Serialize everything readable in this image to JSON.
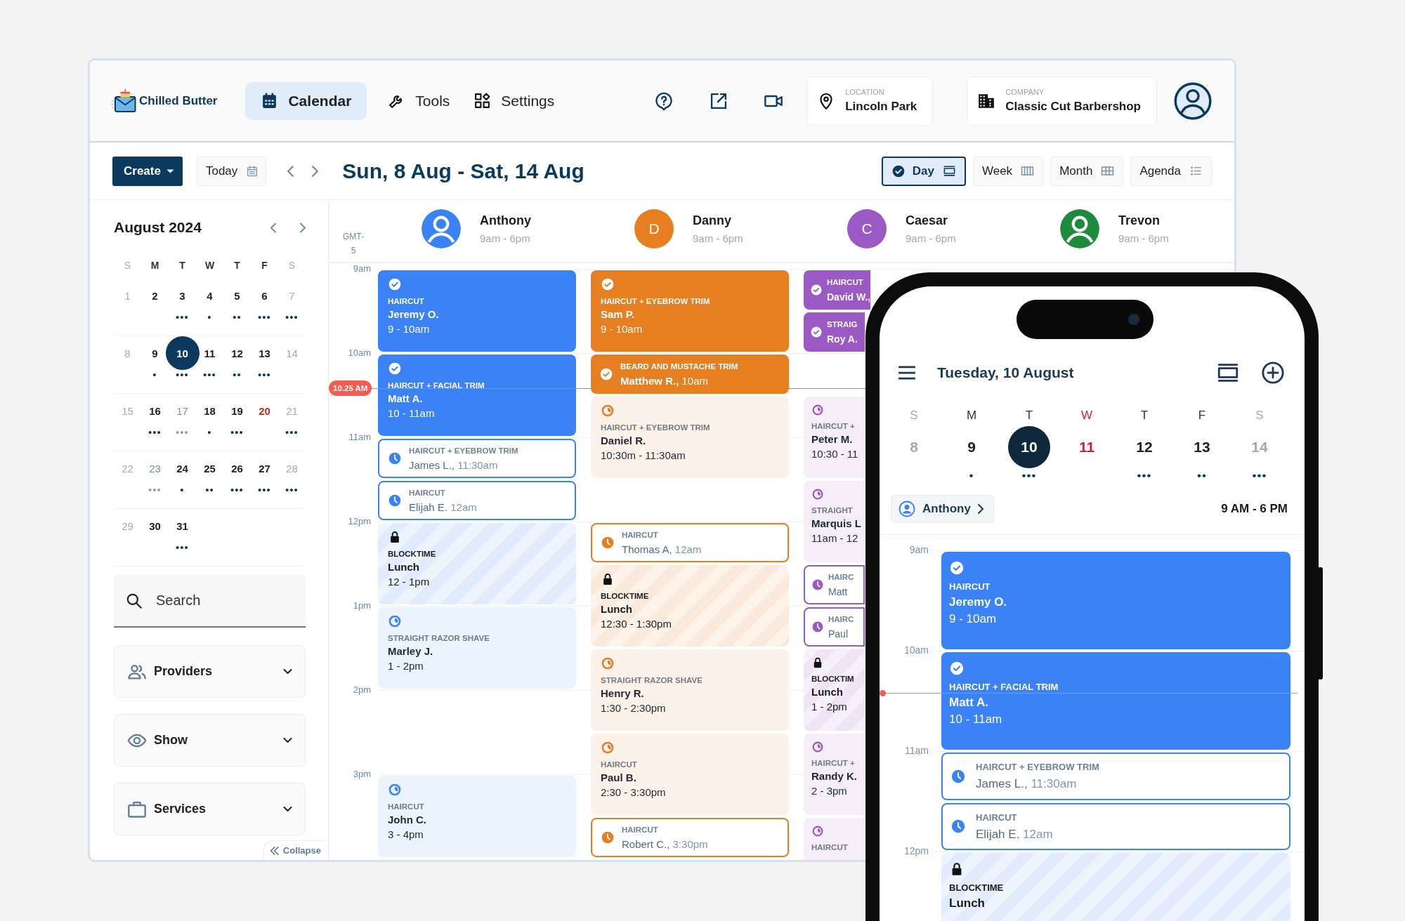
{
  "header": {
    "logo": "Chilled Butter",
    "nav": [
      {
        "label": "Calendar",
        "selected": true
      },
      {
        "label": "Tools",
        "selected": false
      },
      {
        "label": "Settings",
        "selected": false
      }
    ],
    "location": {
      "caption": "LOCATION",
      "value": "Lincoln Park"
    },
    "company": {
      "caption": "COMPANY",
      "value": "Classic Cut Barbershop"
    }
  },
  "toolbar": {
    "create": "Create",
    "today": "Today",
    "range": "Sun, 8 Aug - Sat, 14 Aug",
    "views": [
      {
        "label": "Day",
        "selected": true
      },
      {
        "label": "Week",
        "selected": false
      },
      {
        "label": "Month",
        "selected": false
      },
      {
        "label": "Agenda",
        "selected": false
      }
    ]
  },
  "sidebar": {
    "month": "August 2024",
    "weekdays": [
      "S",
      "M",
      "T",
      "W",
      "T",
      "F",
      "S"
    ],
    "weeks": [
      [
        {
          "day": "1",
          "kind": "weekend",
          "selected": false
        },
        {
          "day": "2",
          "kind": "normal",
          "selected": false
        },
        {
          "day": "3",
          "kind": "normal",
          "selected": false,
          "dots": "•••"
        },
        {
          "day": "4",
          "kind": "normal",
          "selected": false,
          "dots": "•"
        },
        {
          "day": "5",
          "kind": "normal",
          "selected": false,
          "dots": "••"
        },
        {
          "day": "6",
          "kind": "normal",
          "selected": false,
          "dots": "•••"
        },
        {
          "day": "7",
          "kind": "weekend",
          "selected": false,
          "dots": "•••"
        }
      ],
      [
        {
          "day": "8",
          "kind": "weekend",
          "selected": false
        },
        {
          "day": "9",
          "kind": "normal",
          "selected": false,
          "dots": "•"
        },
        {
          "day": "10",
          "kind": "normal",
          "selected": true,
          "dots": "•••"
        },
        {
          "day": "11",
          "kind": "normal",
          "selected": false,
          "dots": "•••"
        },
        {
          "day": "12",
          "kind": "normal",
          "selected": false,
          "dots": "••"
        },
        {
          "day": "13",
          "kind": "normal",
          "selected": false,
          "dots": "•••"
        },
        {
          "day": "14",
          "kind": "weekend",
          "selected": false
        }
      ],
      [
        {
          "day": "15",
          "kind": "weekend",
          "selected": false
        },
        {
          "day": "16",
          "kind": "normal",
          "selected": false,
          "dots": "•••"
        },
        {
          "day": "17",
          "kind": "muted",
          "selected": false,
          "dots": "•••"
        },
        {
          "day": "18",
          "kind": "normal",
          "selected": false,
          "dots": "•"
        },
        {
          "day": "19",
          "kind": "normal",
          "selected": false,
          "dots": "•••"
        },
        {
          "day": "20",
          "kind": "holiday",
          "selected": false
        },
        {
          "day": "21",
          "kind": "weekend",
          "selected": false,
          "dots": "•••"
        }
      ],
      [
        {
          "day": "22",
          "kind": "weekend",
          "selected": false
        },
        {
          "day": "23",
          "kind": "muted",
          "selected": false,
          "dots": "•••"
        },
        {
          "day": "24",
          "kind": "normal",
          "selected": false,
          "dots": "•"
        },
        {
          "day": "25",
          "kind": "normal",
          "selected": false,
          "dots": "••"
        },
        {
          "day": "26",
          "kind": "normal",
          "selected": false,
          "dots": "•••"
        },
        {
          "day": "27",
          "kind": "normal",
          "selected": false,
          "dots": "•••"
        },
        {
          "day": "28",
          "kind": "weekend",
          "selected": false,
          "dots": "•••"
        }
      ],
      [
        {
          "day": "29",
          "kind": "weekend",
          "selected": false
        },
        {
          "day": "30",
          "kind": "normal",
          "selected": false
        },
        {
          "day": "31",
          "kind": "normal",
          "selected": false,
          "dots": "•••"
        }
      ]
    ],
    "search": {
      "placeholder": "Search"
    },
    "filters": [
      "Providers",
      "Show",
      "Services"
    ],
    "collapse": "Collapse"
  },
  "calendar": {
    "timezone": "GMT-5",
    "hours": [
      "9am",
      "10am",
      "11am",
      "12pm",
      "1pm",
      "2pm",
      "3pm"
    ],
    "now": "10.25 AM",
    "providers": [
      {
        "name": "Anthony",
        "hours": "9am - 6pm",
        "color": "#3b82f6",
        "events": [
          {
            "kind": "confirmed",
            "short": false,
            "service": "HAIRCUT",
            "client": "Jeremy O.",
            "time": "9 - 10am"
          },
          {
            "kind": "confirmed",
            "short": false,
            "service": "HAIRCUT + FACIAL TRIM",
            "client": "Matt A.",
            "time": "10 - 11am"
          },
          {
            "kind": "booked",
            "short": true,
            "service": "HAIRCUT + EYEBROW TRIM",
            "client": "James L.,",
            "time": "11:30am"
          },
          {
            "kind": "booked",
            "short": true,
            "service": "HAIRCUT",
            "client": "Elijah E.",
            "time": "12am"
          },
          {
            "kind": "blocktime",
            "short": false,
            "service": "BLOCKTIME",
            "client": "Lunch",
            "time": "12 - 1pm"
          },
          {
            "kind": "arrived",
            "short": false,
            "service": "STRAIGHT RAZOR SHAVE",
            "client": "Marley J.",
            "time": "1 - 2pm"
          },
          {
            "kind": "free",
            "short": false
          },
          {
            "kind": "arrived",
            "short": false,
            "service": "HAIRCUT",
            "client": "John C.",
            "time": "3 - 4pm"
          }
        ]
      },
      {
        "name": "Danny",
        "hours": "9am - 6pm",
        "color": "#e67e22",
        "initial": "D",
        "events": [
          {
            "kind": "confirmed",
            "short": false,
            "service": "HAIRCUT + EYEBROW TRIM",
            "client": "Sam P.",
            "time": "9 - 10am"
          },
          {
            "kind": "confirmed-inline",
            "short": true,
            "service": "BEARD AND MUSTACHE TRIM",
            "client": "Matthew R.,",
            "time": "10am"
          },
          {
            "kind": "arrived",
            "short": false,
            "service": "HAIRCUT + EYEBROW TRIM",
            "client": "Daniel R.",
            "time": "10:30m - 11:30am"
          },
          {
            "kind": "free",
            "short": true
          },
          {
            "kind": "booked",
            "short": true,
            "service": "HAIRCUT",
            "client": "Thomas A,",
            "time": "12am"
          },
          {
            "kind": "blocktime",
            "short": false,
            "service": "BLOCKTIME",
            "client": "Lunch",
            "time": "12:30 - 1:30pm"
          },
          {
            "kind": "arrived",
            "short": false,
            "service": "STRAIGHT RAZOR SHAVE",
            "client": "Henry R.",
            "time": "1:30 - 2:30pm"
          },
          {
            "kind": "arrived",
            "short": false,
            "service": "HAIRCUT",
            "client": "Paul B.",
            "time": "2:30 - 3:30pm"
          },
          {
            "kind": "booked",
            "short": true,
            "service": "HAIRCUT",
            "client": "Robert C.,",
            "time": "3:30pm"
          }
        ]
      },
      {
        "name": "Caesar",
        "hours": "9am - 6pm",
        "color": "#9b59c4",
        "initial": "C",
        "events": [
          {
            "kind": "confirmed-inline",
            "short": true,
            "service": "HAIRCUT",
            "client": "David W.,"
          },
          {
            "kind": "confirmed-inline",
            "short": true,
            "service": "STRAIG",
            "client": "Roy A."
          },
          {
            "kind": "free",
            "short": true
          },
          {
            "kind": "arrived",
            "short": false,
            "service": "HAIRCUT +",
            "client": "Peter M.",
            "time": "10:30 - 11"
          },
          {
            "kind": "arrived",
            "short": false,
            "service": "STRAIGHT",
            "client": "Marquis L",
            "time": "11am - 12"
          },
          {
            "kind": "booked",
            "short": true,
            "service": "HAIRC",
            "client": "Matt"
          },
          {
            "kind": "booked",
            "short": true,
            "service": "HAIRC",
            "client": "Paul"
          },
          {
            "kind": "blocktime",
            "short": false,
            "service": "BLOCKTIM",
            "client": "Lunch",
            "time": "1 - 2pm"
          },
          {
            "kind": "arrived",
            "short": false,
            "service": "HAIRCUT +",
            "client": "Randy K.",
            "time": "2 - 3pm"
          },
          {
            "kind": "arrived",
            "short": false,
            "service": "HAIRCUT"
          }
        ]
      },
      {
        "name": "Trevon",
        "hours": "9am - 6pm",
        "color": "#1e8a3c"
      }
    ]
  },
  "phone": {
    "title": "Tuesday, 10 August",
    "days": [
      {
        "letter": "S",
        "day": "8",
        "kind": "weekend",
        "selected": false
      },
      {
        "letter": "M",
        "day": "9",
        "kind": "normal",
        "selected": false,
        "dots": "•"
      },
      {
        "letter": "T",
        "day": "10",
        "kind": "normal",
        "selected": true,
        "dots": "•••"
      },
      {
        "letter": "W",
        "day": "11",
        "kind": "holiday",
        "selected": false
      },
      {
        "letter": "T",
        "day": "12",
        "kind": "normal",
        "selected": false,
        "dots": "•••"
      },
      {
        "letter": "F",
        "day": "13",
        "kind": "normal",
        "selected": false,
        "dots": "••"
      },
      {
        "letter": "S",
        "day": "14",
        "kind": "weekend",
        "selected": false,
        "dots": "•••"
      }
    ],
    "provider": "Anthony",
    "hours": "9 AM - 6 PM",
    "color": "#3b82f6",
    "times": [
      "9am",
      "10am",
      "11am",
      "12pm"
    ],
    "events": [
      {
        "kind": "confirmed",
        "short": false,
        "service": "HAIRCUT",
        "client": "Jeremy O.",
        "time": "9 - 10am"
      },
      {
        "kind": "confirmed",
        "short": false,
        "service": "HAIRCUT + FACIAL TRIM",
        "client": "Matt A.",
        "time": "10 - 11am"
      },
      {
        "kind": "booked",
        "short": true,
        "service": "HAIRCUT + EYEBROW TRIM",
        "client": "James L.,",
        "time": "11:30am"
      },
      {
        "kind": "booked",
        "short": true,
        "service": "HAIRCUT",
        "client": "Elijah E.",
        "time": "12am"
      },
      {
        "kind": "blocktime",
        "short": false,
        "service": "BLOCKTIME",
        "client": "Lunch"
      }
    ]
  }
}
